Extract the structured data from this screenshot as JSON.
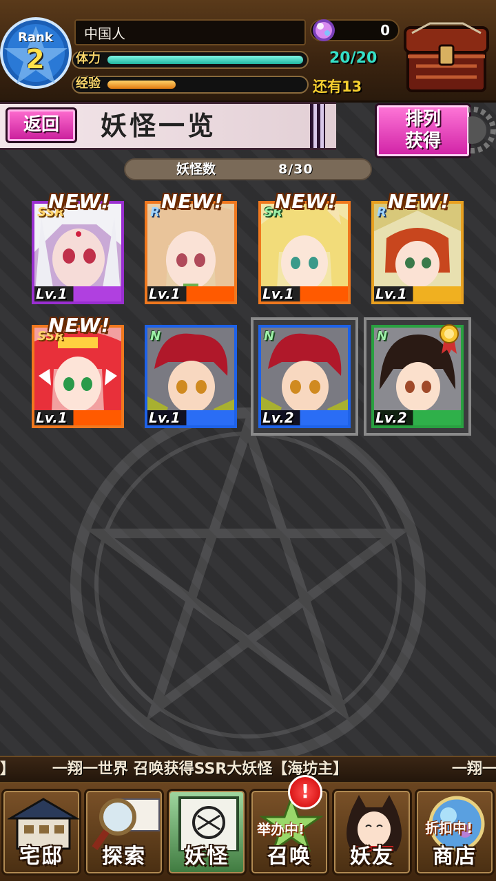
{
  "player": {
    "rank_label": "Rank",
    "rank_value": "2",
    "name": "中国人",
    "gems": "0",
    "stamina_label": "体力",
    "stamina_value": "20/20",
    "stamina_fraction": 1.0,
    "exp_label": "经验",
    "exp_fraction": 0.35,
    "exp_remaining": "还有13"
  },
  "header": {
    "back_label": "返回",
    "title": "妖怪一览",
    "sort_line1": "排列",
    "sort_line2": "获得"
  },
  "count": {
    "label": "妖怪数",
    "value": "8/30"
  },
  "cards": [
    {
      "new": "NEW!",
      "rarity": "SSR",
      "level": "Lv.1"
    },
    {
      "new": "NEW!",
      "rarity": "R",
      "level": "Lv.1"
    },
    {
      "new": "NEW!",
      "rarity": "SR",
      "level": "Lv.1"
    },
    {
      "new": "NEW!",
      "rarity": "R",
      "level": "Lv.1"
    },
    {
      "new": "NEW!",
      "rarity": "SSR",
      "level": "Lv.1"
    },
    {
      "new": "",
      "rarity": "N",
      "level": "Lv.1"
    },
    {
      "new": "",
      "rarity": "N",
      "level": "Lv.2"
    },
    {
      "new": "",
      "rarity": "N",
      "level": "Lv.2"
    }
  ],
  "ticker": {
    "left_fragment": "】",
    "message": "一翔一世界 召唤获得SSR大妖怪【海坊主】",
    "right_fragment": "一翔一"
  },
  "nav": {
    "items": [
      {
        "label": "宅邸",
        "icon": "mansion-icon"
      },
      {
        "label": "探索",
        "icon": "magnifier-map-icon"
      },
      {
        "label": "妖怪",
        "icon": "yokai-scroll-icon"
      },
      {
        "label": "召唤",
        "icon": "summon-icon"
      },
      {
        "label": "妖友",
        "icon": "friend-girl-icon"
      },
      {
        "label": "商店",
        "icon": "shop-orb-icon"
      }
    ],
    "summon_alert": "!",
    "summon_promo": "举办中!",
    "shop_promo": "折扣中!"
  },
  "colors": {
    "ssr_border": "#f0781e",
    "n_blue_border": "#1e62e8",
    "n_green_border": "#29a040",
    "button_pink": "#d021a5",
    "stamina_teal": "#35e0c8",
    "exp_orange": "#f29a1a"
  }
}
